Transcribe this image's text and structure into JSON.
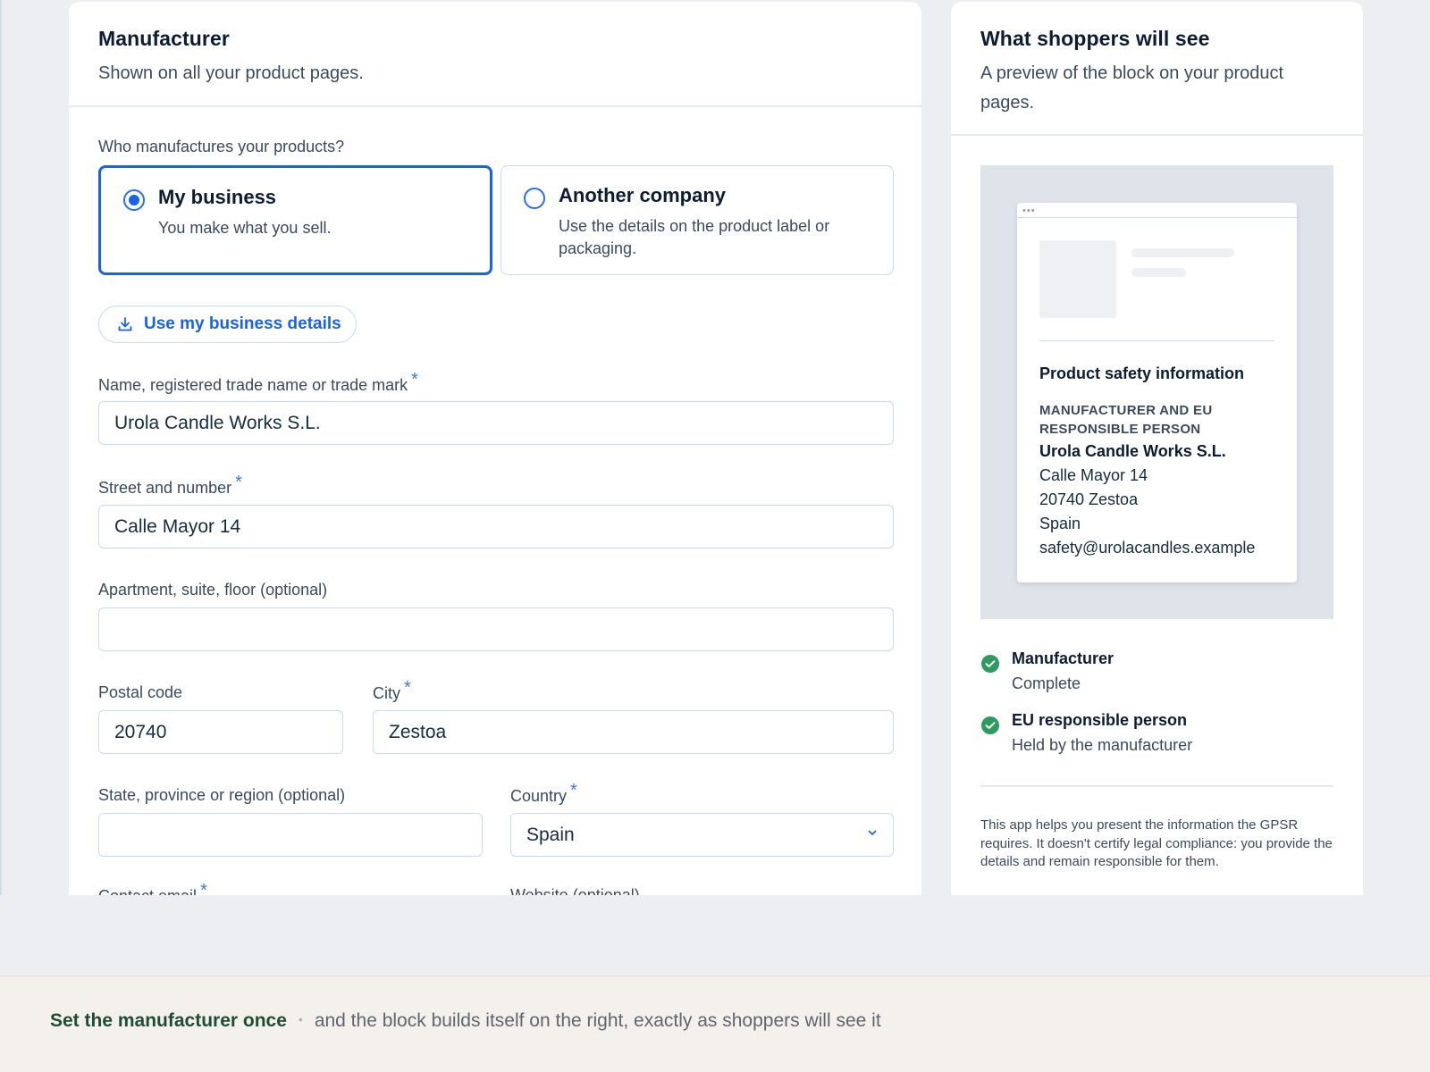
{
  "manufacturer_card": {
    "title": "Manufacturer",
    "subtitle": "Shown on all your product pages.",
    "question": "Who manufactures your products?",
    "options": [
      {
        "title": "My business",
        "description": "You make what you sell.",
        "selected": true
      },
      {
        "title": "Another company",
        "description": "Use the details on the product label or packaging.",
        "selected": false
      }
    ],
    "use_details_button": "Use my business details",
    "required_mark": "*",
    "fields": {
      "name": {
        "label": "Name, registered trade name or trade mark",
        "value": "Urola Candle Works S.L."
      },
      "street": {
        "label": "Street and number",
        "value": "Calle Mayor 14"
      },
      "apartment": {
        "label": "Apartment, suite, floor (optional)",
        "value": ""
      },
      "postal": {
        "label": "Postal code",
        "value": "20740"
      },
      "city": {
        "label": "City",
        "value": "Zestoa"
      },
      "state": {
        "label": "State, province or region (optional)",
        "value": ""
      },
      "country": {
        "label": "Country",
        "value": "Spain"
      },
      "email": {
        "label": "Contact email"
      },
      "website": {
        "label": "Website (optional)"
      }
    }
  },
  "preview_card": {
    "title": "What shoppers will see",
    "subtitle": "A preview of the block on your product pages.",
    "mini": {
      "dots": "•••",
      "heading": "Product safety information",
      "caps": "MANUFACTURER AND EU RESPONSIBLE PERSON",
      "name": "Urola Candle Works S.L.",
      "street": "Calle Mayor 14",
      "city_line": "20740 Zestoa",
      "country": "Spain",
      "email": "safety@urolacandles.example"
    },
    "status": [
      {
        "title": "Manufacturer",
        "sub": "Complete",
        "icon": "check-circle-icon",
        "color": "#2e9b5e"
      },
      {
        "title": "EU responsible person",
        "sub": "Held by the manufacturer",
        "icon": "check-circle-icon",
        "color": "#2e9b5e"
      }
    ],
    "disclaimer": "This app helps you present the information the GPSR requires. It doesn't certify legal compliance: you provide the details and remain responsible for them."
  },
  "footer": {
    "strong": "Set the manufacturer once",
    "separator": "•",
    "rest": "and the block builds itself on the right, exactly as shoppers will see it"
  },
  "colors": {
    "accent": "#1a62e8",
    "success": "#2e9b5e",
    "footer_green": "#1f4d33"
  }
}
